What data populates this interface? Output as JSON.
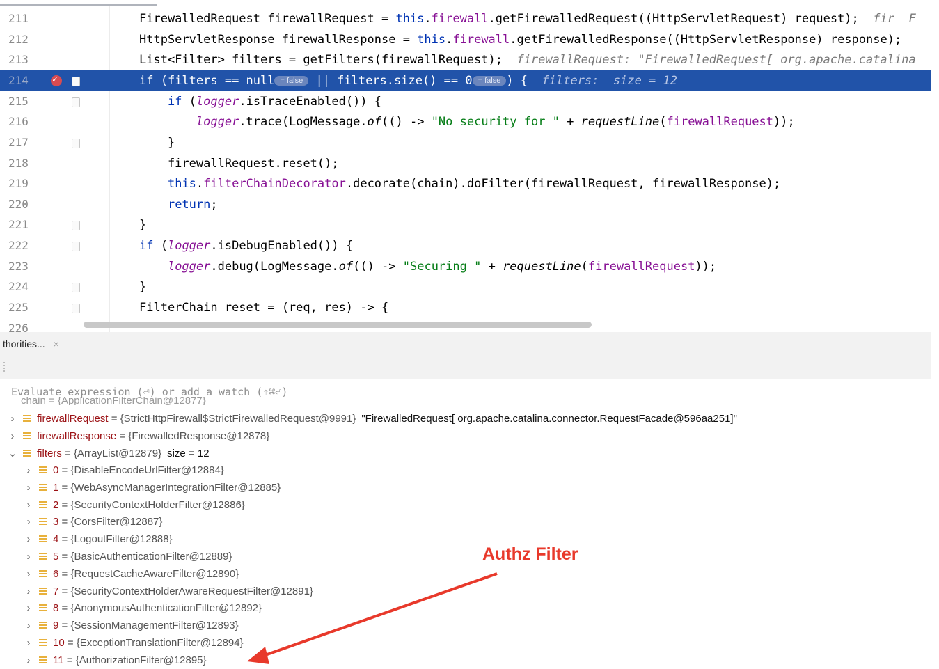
{
  "editor": {
    "lines": [
      {
        "no": "211",
        "code": [
          {
            "t": "FirewalledRequest firewallRequest = "
          },
          {
            "t": "this",
            "c": "kw"
          },
          {
            "t": "."
          },
          {
            "t": "firewall",
            "c": "fld"
          },
          {
            "t": ".getFirewalledRequest((HttpServletRequest) request);  "
          },
          {
            "t": "fir",
            "c": "hint"
          },
          {
            "t": "  ",
            "c": ""
          },
          {
            "t": "F",
            "c": "hint"
          }
        ]
      },
      {
        "no": "212",
        "code": [
          {
            "t": "HttpServletResponse firewallResponse = "
          },
          {
            "t": "this",
            "c": "kw"
          },
          {
            "t": "."
          },
          {
            "t": "firewall",
            "c": "fld"
          },
          {
            "t": ".getFirewalledResponse((HttpServletResponse) response);"
          }
        ]
      },
      {
        "no": "213",
        "code": [
          {
            "t": "List<Filter> filters = getFilters(firewallRequest);  "
          },
          {
            "t": "firewallRequest: \"FirewalledRequest[ org.apache.catalina",
            "c": "hint"
          }
        ]
      },
      {
        "no": "214",
        "hl": true,
        "bp": true,
        "code": [
          {
            "t": "if",
            "c": "kw"
          },
          {
            "t": " (filters == null"
          },
          {
            "pill": "= false"
          },
          {
            "t": " || filters.size() == 0"
          },
          {
            "pill": "= false"
          },
          {
            "t": ") {  "
          },
          {
            "t": "filters:  size = 12",
            "c": "hint"
          }
        ]
      },
      {
        "no": "215",
        "code": [
          {
            "t": "    "
          },
          {
            "t": "if",
            "c": "kw"
          },
          {
            "t": " ("
          },
          {
            "t": "logger",
            "c": "fld it"
          },
          {
            "t": ".isTraceEnabled()) {"
          }
        ]
      },
      {
        "no": "216",
        "code": [
          {
            "t": "        "
          },
          {
            "t": "logger",
            "c": "fld it"
          },
          {
            "t": ".trace(LogMessage."
          },
          {
            "t": "of",
            "c": "it"
          },
          {
            "t": "(() -> "
          },
          {
            "t": "\"No security for \"",
            "c": "str"
          },
          {
            "t": " + "
          },
          {
            "t": "requestLine",
            "c": "it"
          },
          {
            "t": "("
          },
          {
            "t": "firewallRequest",
            "c": "fld"
          },
          {
            "t": "));"
          }
        ]
      },
      {
        "no": "217",
        "code": [
          {
            "t": "    }"
          }
        ]
      },
      {
        "no": "218",
        "code": [
          {
            "t": "    firewallRequest.reset();"
          }
        ]
      },
      {
        "no": "219",
        "code": [
          {
            "t": "    "
          },
          {
            "t": "this",
            "c": "kw"
          },
          {
            "t": "."
          },
          {
            "t": "filterChainDecorator",
            "c": "fld"
          },
          {
            "t": ".decorate(chain).doFilter(firewallRequest, firewallResponse);"
          }
        ]
      },
      {
        "no": "220",
        "code": [
          {
            "t": "    "
          },
          {
            "t": "return",
            "c": "kw"
          },
          {
            "t": ";"
          }
        ]
      },
      {
        "no": "221",
        "code": [
          {
            "t": "}"
          }
        ]
      },
      {
        "no": "222",
        "code": [
          {
            "t": "if",
            "c": "kw"
          },
          {
            "t": " ("
          },
          {
            "t": "logger",
            "c": "fld it"
          },
          {
            "t": ".isDebugEnabled()) {"
          }
        ]
      },
      {
        "no": "223",
        "code": [
          {
            "t": "    "
          },
          {
            "t": "logger",
            "c": "fld it"
          },
          {
            "t": ".debug(LogMessage."
          },
          {
            "t": "of",
            "c": "it"
          },
          {
            "t": "(() -> "
          },
          {
            "t": "\"Securing \"",
            "c": "str"
          },
          {
            "t": " + "
          },
          {
            "t": "requestLine",
            "c": "it"
          },
          {
            "t": "("
          },
          {
            "t": "firewallRequest",
            "c": "fld"
          },
          {
            "t": "));"
          }
        ]
      },
      {
        "no": "224",
        "code": [
          {
            "t": "}"
          }
        ]
      },
      {
        "no": "225",
        "code": [
          {
            "t": "FilterChain reset = (req, res) -> {"
          }
        ]
      },
      {
        "no": "226",
        "code": []
      }
    ]
  },
  "debugger": {
    "tab_label": "thorities...",
    "tab_close": "×",
    "eval_placeholder": "Evaluate expression (⏎) or add a watch (⇧⌘⏎)",
    "cut_row": "chain = {ApplicationFilterChain@12877}",
    "variables": [
      {
        "chev": "›",
        "name": "firewallRequest",
        "val": "{StrictHttpFirewall$StrictFirewalledRequest@9991}",
        "extra": "\"FirewalledRequest[ org.apache.catalina.connector.RequestFacade@596aa251]\""
      },
      {
        "chev": "›",
        "name": "firewallResponse",
        "val": "{FirewalledResponse@12878}",
        "extra": ""
      },
      {
        "chev": "⌄",
        "name": "filters",
        "val": "{ArrayList@12879}",
        "extra": "size = 12"
      }
    ],
    "filters": [
      {
        "idx": "0",
        "val": "{DisableEncodeUrlFilter@12884}"
      },
      {
        "idx": "1",
        "val": "{WebAsyncManagerIntegrationFilter@12885}"
      },
      {
        "idx": "2",
        "val": "{SecurityContextHolderFilter@12886}"
      },
      {
        "idx": "3",
        "val": "{CorsFilter@12887}"
      },
      {
        "idx": "4",
        "val": "{LogoutFilter@12888}"
      },
      {
        "idx": "5",
        "val": "{BasicAuthenticationFilter@12889}"
      },
      {
        "idx": "6",
        "val": "{RequestCacheAwareFilter@12890}"
      },
      {
        "idx": "7",
        "val": "{SecurityContextHolderAwareRequestFilter@12891}"
      },
      {
        "idx": "8",
        "val": "{AnonymousAuthenticationFilter@12892}"
      },
      {
        "idx": "9",
        "val": "{SessionManagementFilter@12893}"
      },
      {
        "idx": "10",
        "val": "{ExceptionTranslationFilter@12894}"
      },
      {
        "idx": "11",
        "val": "{AuthorizationFilter@12895}"
      }
    ]
  },
  "annotation": {
    "label": "Authz Filter",
    "color": "#e8392b"
  }
}
